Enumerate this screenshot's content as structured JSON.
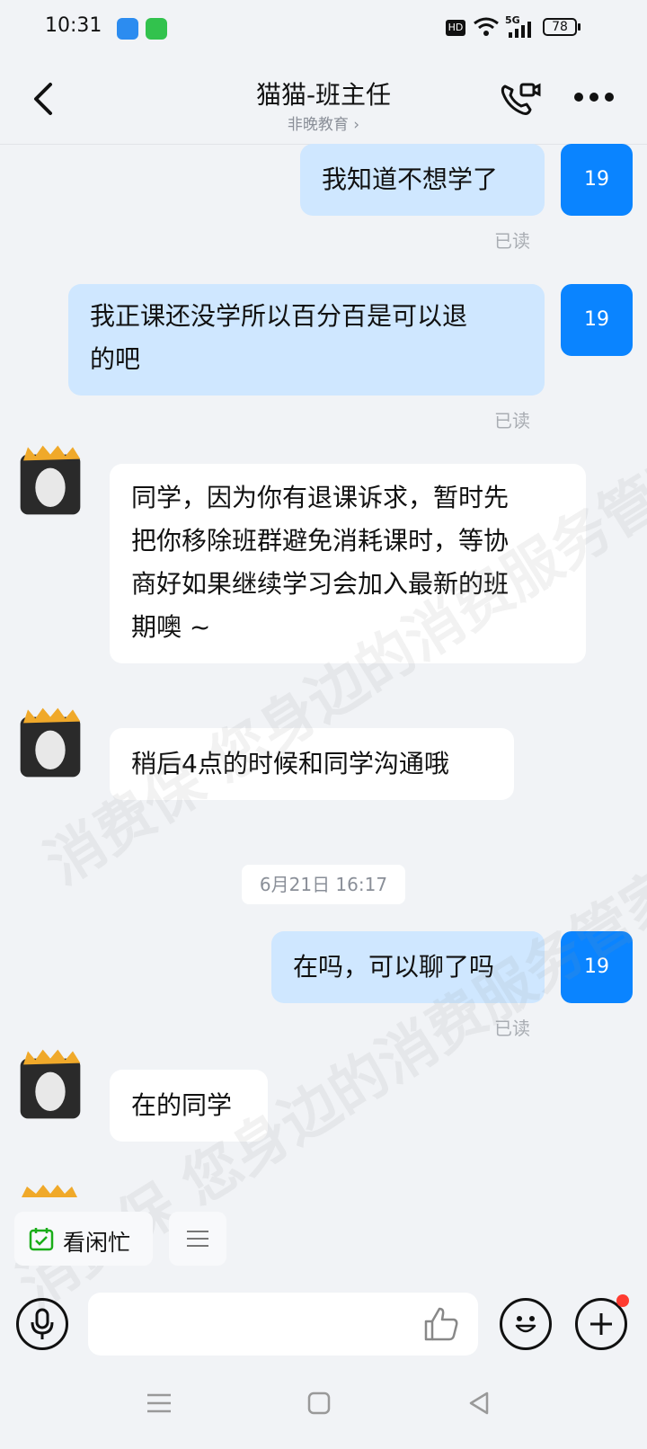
{
  "status_bar": {
    "time": "10:31",
    "network": "5G",
    "hd": "HD",
    "battery": "78",
    "icons": [
      "notification-app-icon",
      "wechat-icon",
      "hd-icon",
      "wifi-icon",
      "signal-icon",
      "battery-icon"
    ]
  },
  "header": {
    "title": "猫猫-班主任",
    "subtitle": "非晚教育",
    "icons": [
      "back-icon",
      "video-call-icon",
      "more-icon"
    ]
  },
  "messages": [
    {
      "side": "out",
      "text": "我知道不想学了",
      "avatar": "19",
      "status": "已读"
    },
    {
      "side": "out",
      "text_lines": [
        "我正课还没学所以百分百是可以退",
        "的吧"
      ],
      "avatar": "19",
      "status": "已读"
    },
    {
      "side": "in",
      "text_lines": [
        "同学，因为你有退课诉求，暂时先",
        "把你移除班群避免消耗课时，等协",
        "商好如果继续学习会加入最新的班",
        "期噢 ~"
      ]
    },
    {
      "side": "in",
      "text": "稍后4点的时候和同学沟通哦"
    },
    {
      "timestamp": "6月21日 16:17"
    },
    {
      "side": "out",
      "text": "在吗，可以聊了吗",
      "avatar": "19",
      "status": "已读"
    },
    {
      "side": "in",
      "text": "在的同学"
    }
  ],
  "watermark": {
    "text_a": "消费保 您身边的消费服务管家",
    "text_b": "消费保 您身边的消费服务管家"
  },
  "quick_actions": {
    "availability_label": "看闲忙",
    "menu_icon": "menu-icon"
  },
  "input_bar": {
    "placeholder": "",
    "icons": [
      "voice-icon",
      "thumbs-up-icon",
      "emoji-icon",
      "plus-icon"
    ]
  },
  "nav_bar": {
    "icons": [
      "menu-nav-icon",
      "home-nav-icon",
      "back-nav-icon"
    ]
  },
  "colors": {
    "accent": "#0a84ff",
    "bubble_out": "#cfe7ff",
    "bubble_in": "#ffffff",
    "background": "#f1f3f6",
    "notification_dot": "#ff3b30",
    "availability_green": "#1aad19"
  }
}
